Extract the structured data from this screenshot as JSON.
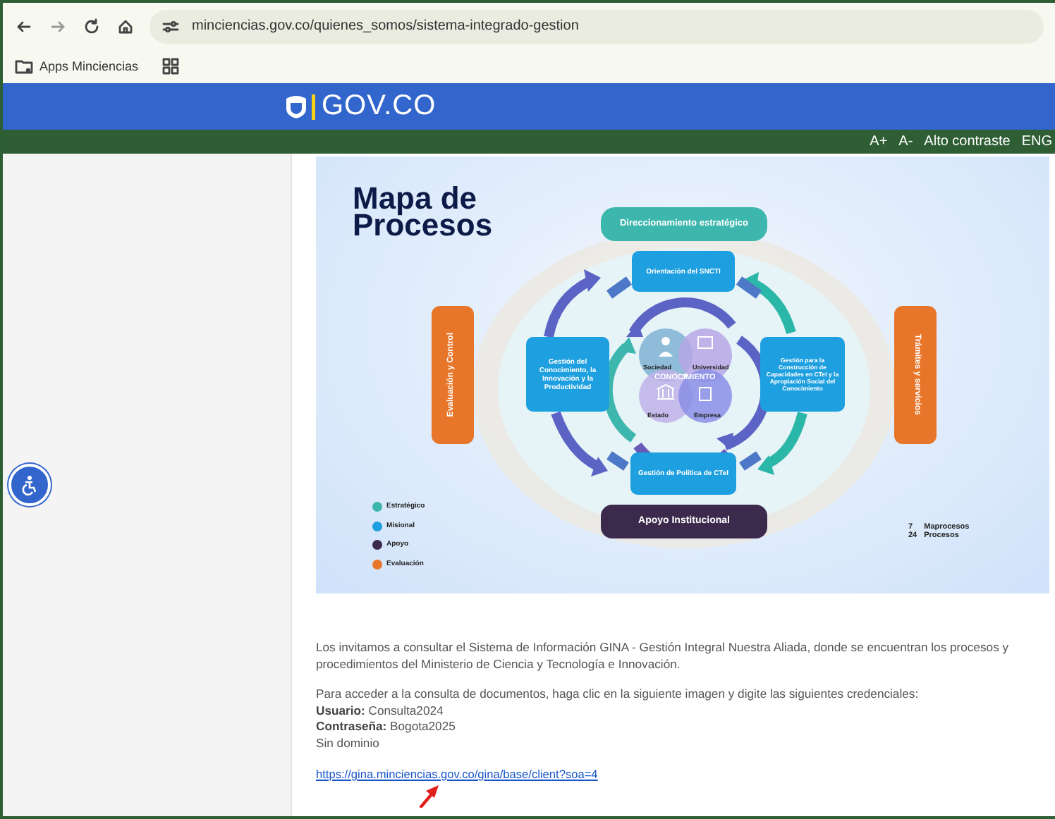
{
  "browser": {
    "url": "minciencias.gov.co/quienes_somos/sistema-integrado-gestion",
    "bookmarks": [
      {
        "label": "Apps Minciencias"
      }
    ]
  },
  "gov_bar": {
    "logo_text": "GOV.CO"
  },
  "utility_bar": {
    "items": [
      "A+",
      "A-",
      "Alto contraste",
      "ENG"
    ]
  },
  "process_map": {
    "title": "Mapa de Procesos",
    "strategic": "Direccionamiento estratégico",
    "misional": [
      "Orientación del SNCTI",
      "Gestión del Conocimiento, la Innovación y la Productividad",
      "Gestión para la Construcción de Capacidades en CTeI y la Apropiación Social del Conocimiento",
      "Gestión de Política de CTeI"
    ],
    "support": "Apoyo Institucional",
    "evaluation": "Evaluación y Control",
    "services": "Trámites y servicios",
    "center": {
      "label": "CONOCIMIENTO",
      "actors": [
        "Sociedad",
        "Universidad",
        "Estado",
        "Empresa"
      ]
    },
    "legend": [
      {
        "label": "Estratégico",
        "color": "#3db6ad"
      },
      {
        "label": "Misional",
        "color": "#1d9fe0"
      },
      {
        "label": "Apoyo",
        "color": "#3b2a4c"
      },
      {
        "label": "Evaluación",
        "color": "#e8762a"
      }
    ],
    "totals": [
      {
        "count": "7",
        "label": "Maprocesos"
      },
      {
        "count": "24",
        "label": "Procesos"
      }
    ]
  },
  "intro": "Los invitamos a consultar el Sistema de Información GINA - Gestión Integral Nuestra Aliada, donde se encuentran los procesos y procedimientos del Ministerio de Ciencia y Tecnología e Innovación.",
  "access_text": "Para acceder a la consulta de documentos, haga clic en la siguiente imagen y digite las siguientes credenciales:",
  "credentials": [
    {
      "label": "Usuario:",
      "value": "Consulta2024"
    },
    {
      "label": "Contraseña:",
      "value": "Bogota2025"
    }
  ],
  "note": "Sin dominio",
  "link": "https://gina.minciencias.gov.co/gina/base/client?soa=4"
}
